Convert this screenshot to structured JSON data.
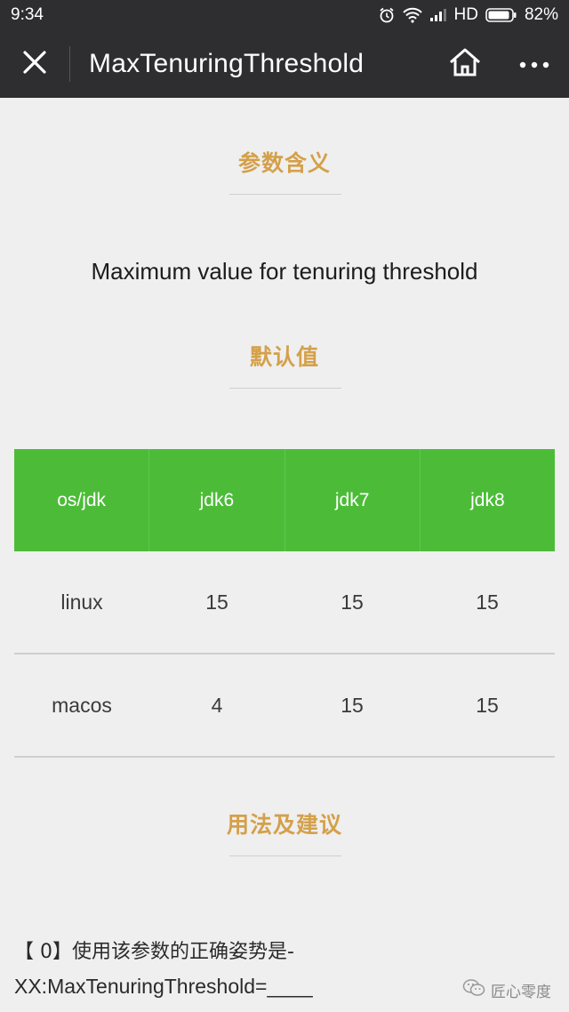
{
  "status_bar": {
    "time": "9:34",
    "network": "HD",
    "battery": "82%"
  },
  "title_bar": {
    "title": "MaxTenuringThreshold"
  },
  "sections": {
    "meaning_heading": "参数含义",
    "meaning_text": "Maximum value for tenuring threshold",
    "default_heading": "默认值",
    "usage_heading": "用法及建议"
  },
  "table": {
    "headers": [
      "os/jdk",
      "jdk6",
      "jdk7",
      "jdk8"
    ],
    "rows": [
      [
        "linux",
        "15",
        "15",
        "15"
      ],
      [
        "macos",
        "4",
        "15",
        "15"
      ]
    ]
  },
  "usage": {
    "line1": "【 0】使用该参数的正确姿势是-",
    "line2": "XX:MaxTenuringThreshold=____"
  },
  "watermark": {
    "text": "匠心零度"
  },
  "colors": {
    "header_bg": "#2e2e30",
    "accent": "#d4a04a",
    "table_header": "#4cbc38"
  }
}
